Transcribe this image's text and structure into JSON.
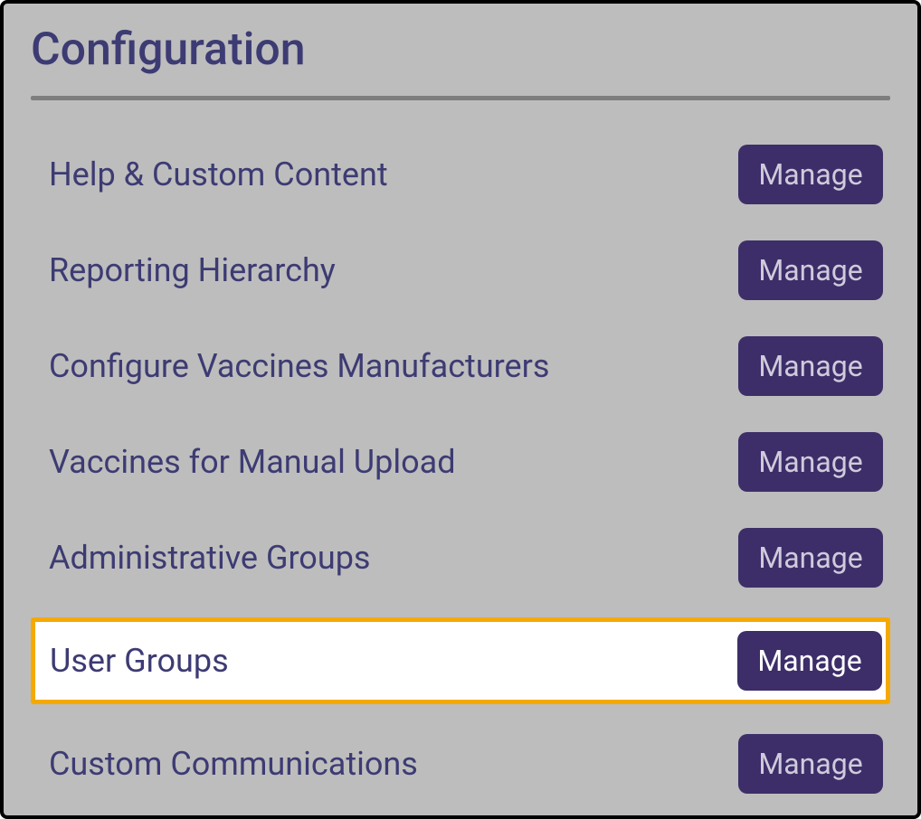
{
  "title": "Configuration",
  "manage_label": "Manage",
  "items": [
    {
      "label": "Help & Custom Content",
      "highlight": false
    },
    {
      "label": "Reporting Hierarchy",
      "highlight": false
    },
    {
      "label": "Configure Vaccines Manufacturers",
      "highlight": false
    },
    {
      "label": "Vaccines for Manual Upload",
      "highlight": false
    },
    {
      "label": "Administrative Groups",
      "highlight": false
    },
    {
      "label": "User Groups",
      "highlight": true
    },
    {
      "label": "Custom Communications",
      "highlight": false
    }
  ]
}
